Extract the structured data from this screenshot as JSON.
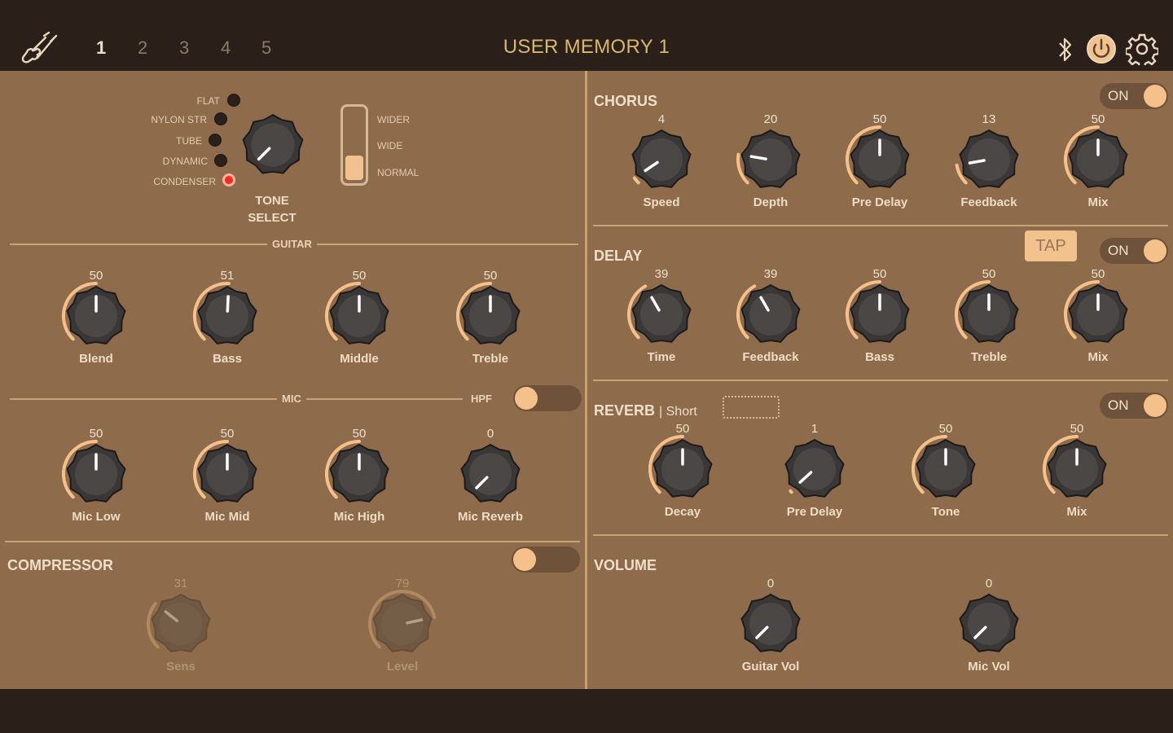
{
  "topbar": {
    "title": "USER MEMORY 1",
    "memories": [
      "1",
      "2",
      "3",
      "4",
      "5"
    ],
    "active_memory": "1",
    "icons": [
      "guitar-icon",
      "bluetooth-icon",
      "power-icon",
      "gear-icon"
    ]
  },
  "tone_select": {
    "options": [
      "FLAT",
      "NYLON STR",
      "TUBE",
      "DYNAMIC",
      "CONDENSER"
    ],
    "selected": "CONDENSER",
    "title_line1": "TONE",
    "title_line2": "SELECT",
    "width_options": [
      "WIDER",
      "WIDE",
      "NORMAL"
    ],
    "width_selected": "NORMAL"
  },
  "guitar": {
    "label": "GUITAR",
    "knobs": [
      {
        "label": "Blend",
        "value": "50"
      },
      {
        "label": "Bass",
        "value": "51"
      },
      {
        "label": "Middle",
        "value": "50"
      },
      {
        "label": "Treble",
        "value": "50"
      }
    ]
  },
  "mic": {
    "label": "MIC",
    "hpf_label": "HPF",
    "hpf_on": false,
    "knobs": [
      {
        "label": "Mic Low",
        "value": "50"
      },
      {
        "label": "Mic Mid",
        "value": "50"
      },
      {
        "label": "Mic High",
        "value": "50"
      },
      {
        "label": "Mic Reverb",
        "value": "0"
      }
    ]
  },
  "compressor": {
    "title": "COMPRESSOR",
    "on": false,
    "knobs": [
      {
        "label": "Sens",
        "value": "31"
      },
      {
        "label": "Level",
        "value": "79"
      }
    ]
  },
  "chorus": {
    "title": "CHORUS",
    "toggle_label": "ON",
    "knobs": [
      {
        "label": "Speed",
        "value": "4"
      },
      {
        "label": "Depth",
        "value": "20"
      },
      {
        "label": "Pre Delay",
        "value": "50"
      },
      {
        "label": "Feedback",
        "value": "13"
      },
      {
        "label": "Mix",
        "value": "50"
      }
    ]
  },
  "delay": {
    "title": "DELAY",
    "tap_label": "TAP",
    "toggle_label": "ON",
    "knobs": [
      {
        "label": "Time",
        "value": "39"
      },
      {
        "label": "Feedback",
        "value": "39"
      },
      {
        "label": "Bass",
        "value": "50"
      },
      {
        "label": "Treble",
        "value": "50"
      },
      {
        "label": "Mix",
        "value": "50"
      }
    ]
  },
  "reverb": {
    "title": "REVERB",
    "subtitle": "| Short",
    "toggle_label": "ON",
    "knobs": [
      {
        "label": "Decay",
        "value": "50"
      },
      {
        "label": "Pre Delay",
        "value": "1"
      },
      {
        "label": "Tone",
        "value": "50"
      },
      {
        "label": "Mix",
        "value": "50"
      }
    ]
  },
  "volume": {
    "title": "VOLUME",
    "knobs": [
      {
        "label": "Guitar Vol",
        "value": "0"
      },
      {
        "label": "Mic Vol",
        "value": "0"
      }
    ]
  },
  "colors": {
    "panel": "#8d6b4b",
    "accent": "#f5c18a",
    "title_text": "#d8b96a",
    "led_on": "#ff2a1a"
  }
}
